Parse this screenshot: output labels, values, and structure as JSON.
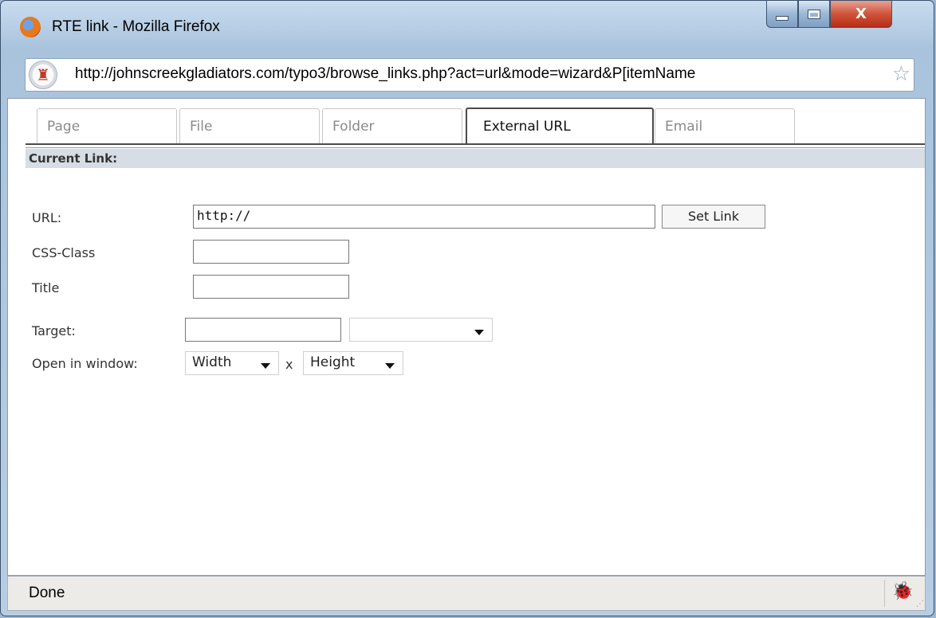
{
  "window": {
    "title": "RTE link - Mozilla Firefox",
    "close_label": "X"
  },
  "address_bar": {
    "url": "http://johnscreekgladiators.com/typo3/browse_links.php?act=url&mode=wizard&P[itemName"
  },
  "tabs": [
    {
      "label": "Page",
      "active": false
    },
    {
      "label": "File",
      "active": false
    },
    {
      "label": "Folder",
      "active": false
    },
    {
      "label": "External URL",
      "active": true
    },
    {
      "label": "Email",
      "active": false
    }
  ],
  "current_link": {
    "header": "Current Link:"
  },
  "form": {
    "url_label": "URL:",
    "url_value": "http://",
    "set_link_label": "Set Link",
    "css_class_label": "CSS-Class",
    "css_class_value": "",
    "title_label": "Title",
    "title_value": "",
    "target_label": "Target:",
    "target_value": "",
    "target_select_value": "",
    "open_window_label": "Open in window:",
    "width_select": "Width",
    "times_label": "x",
    "height_select": "Height"
  },
  "status": {
    "text": "Done"
  },
  "icons": {
    "app": "firefox-icon",
    "site": "site-favicon",
    "bookmark": "star-icon",
    "status": "bug-icon"
  }
}
